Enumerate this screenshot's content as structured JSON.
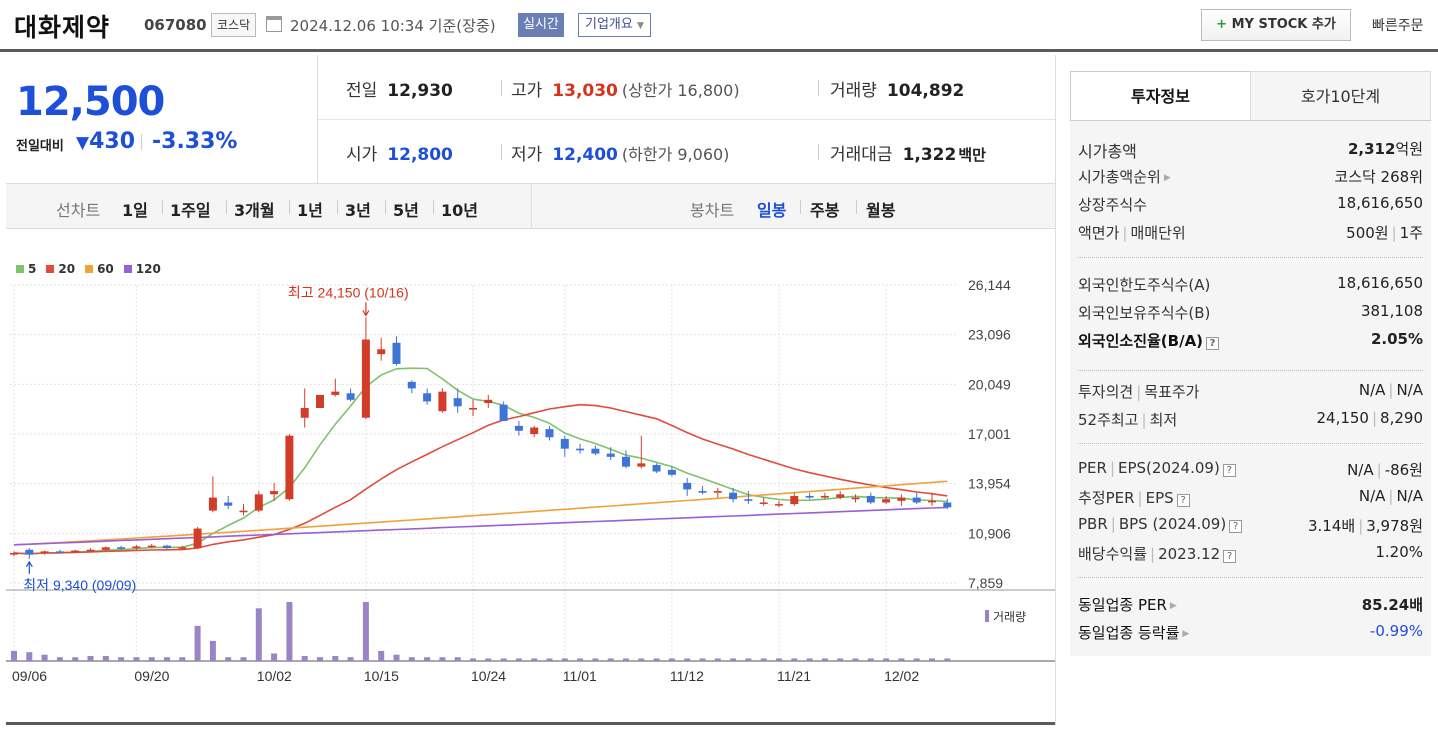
{
  "header": {
    "company_name": "대화제약",
    "code": "067080",
    "market": "코스닥",
    "datetime": "2024.12.06 10:34",
    "basis": "기준(장중)",
    "realtime_label": "실시간",
    "company_info_label": "기업개요",
    "mystock_label": "MY STOCK 추가",
    "quick_order_label": "빠른주문"
  },
  "summary": {
    "price": "12,500",
    "change_label": "전일대비",
    "change_value": "430",
    "change_rate": "-3.33%",
    "prev_close_label": "전일",
    "prev_close": "12,930",
    "high_label": "고가",
    "high": "13,030",
    "upper_limit": "(상한가 16,800)",
    "volume_label": "거래량",
    "volume": "104,892",
    "open_label": "시가",
    "open": "12,800",
    "low_label": "저가",
    "low": "12,400",
    "lower_limit": "(하한가 9,060)",
    "amount_label": "거래대금",
    "amount": "1,322",
    "amount_unit": "백만"
  },
  "periods": {
    "line_chart_label": "선차트",
    "line_options": [
      "1일",
      "1주일",
      "3개월",
      "1년",
      "3년",
      "5년",
      "10년"
    ],
    "candle_chart_label": "봉차트",
    "candle_options": [
      "일봉",
      "주봉",
      "월봉"
    ],
    "candle_selected": "일봉"
  },
  "chart_data": {
    "type": "candlestick",
    "legend": [
      {
        "name": "5",
        "color": "#7cc36b"
      },
      {
        "name": "20",
        "color": "#e24a3b"
      },
      {
        "name": "60",
        "color": "#f0a23a"
      },
      {
        "name": "120",
        "color": "#9a5fd6"
      }
    ],
    "y_ticks": [
      "26,144",
      "23,096",
      "20,049",
      "17,001",
      "13,954",
      "10,906",
      "7,859"
    ],
    "ylim": [
      7859,
      26144
    ],
    "x_ticks": [
      "09/06",
      "09/20",
      "10/02",
      "10/15",
      "10/24",
      "11/01",
      "11/12",
      "11/21",
      "12/02"
    ],
    "x_tick_index": [
      0,
      8,
      16,
      23,
      30,
      36,
      43,
      50,
      57
    ],
    "volume_label": "거래량",
    "max_annotation": "최고 24,150 (10/16)",
    "max_index": 23,
    "max_value": 24150,
    "min_annotation": "최저 9,340 (09/09)",
    "min_index": 1,
    "min_value": 9340,
    "candles": [
      [
        9600,
        9800,
        9500,
        9700
      ],
      [
        9900,
        10000,
        9340,
        9600
      ],
      [
        9700,
        9850,
        9600,
        9800
      ],
      [
        9800,
        9900,
        9700,
        9750
      ],
      [
        9750,
        9900,
        9700,
        9850
      ],
      [
        9850,
        10000,
        9750,
        9900
      ],
      [
        9900,
        10100,
        9800,
        10050
      ],
      [
        10050,
        10150,
        9900,
        9950
      ],
      [
        10000,
        10200,
        9900,
        10100
      ],
      [
        10100,
        10250,
        10000,
        10150
      ],
      [
        10150,
        10200,
        9950,
        10000
      ],
      [
        10000,
        10150,
        9900,
        10050
      ],
      [
        10000,
        11300,
        9950,
        11200
      ],
      [
        12300,
        14400,
        12200,
        13100
      ],
      [
        12800,
        13200,
        12400,
        12600
      ],
      [
        12200,
        12700,
        12000,
        12300
      ],
      [
        12300,
        13500,
        12200,
        13300
      ],
      [
        13300,
        14000,
        12900,
        13500
      ],
      [
        13000,
        17000,
        12900,
        16900
      ],
      [
        18000,
        19800,
        17400,
        18600
      ],
      [
        18600,
        19400,
        18600,
        19400
      ],
      [
        19400,
        20400,
        19300,
        19600
      ],
      [
        19500,
        19800,
        19000,
        19100
      ],
      [
        18000,
        24150,
        17900,
        22800
      ],
      [
        21900,
        22900,
        21500,
        22200
      ],
      [
        22600,
        23000,
        21200,
        21300
      ],
      [
        20200,
        20300,
        19500,
        19800
      ],
      [
        19500,
        19800,
        18800,
        19000
      ],
      [
        18400,
        19800,
        18300,
        19600
      ],
      [
        19200,
        19800,
        18300,
        18700
      ],
      [
        18500,
        19100,
        18100,
        18600
      ],
      [
        18900,
        19400,
        18600,
        19100
      ],
      [
        18800,
        19000,
        17800,
        17800
      ],
      [
        17500,
        17800,
        16900,
        17200
      ],
      [
        17000,
        17500,
        16800,
        17400
      ],
      [
        17300,
        17500,
        16600,
        16800
      ],
      [
        16700,
        16900,
        15600,
        16100
      ],
      [
        16100,
        16400,
        15800,
        16000
      ],
      [
        16100,
        16300,
        15700,
        15800
      ],
      [
        15800,
        16200,
        15400,
        15600
      ],
      [
        15600,
        16000,
        14900,
        15000
      ],
      [
        15000,
        16900,
        14900,
        15200
      ],
      [
        15100,
        15200,
        14600,
        14700
      ],
      [
        14800,
        15000,
        14400,
        14500
      ],
      [
        14000,
        14300,
        13200,
        13600
      ],
      [
        13500,
        13800,
        13300,
        13400
      ],
      [
        13400,
        13700,
        13100,
        13500
      ],
      [
        13400,
        13700,
        12800,
        13000
      ],
      [
        13000,
        13500,
        12700,
        12900
      ],
      [
        12800,
        13100,
        12600,
        12800
      ],
      [
        12700,
        12900,
        12500,
        12700
      ],
      [
        12700,
        13400,
        12600,
        13200
      ],
      [
        13200,
        13400,
        13000,
        13100
      ],
      [
        13100,
        13400,
        13000,
        13200
      ],
      [
        13100,
        13500,
        13000,
        13300
      ],
      [
        13000,
        13300,
        12800,
        13100
      ],
      [
        13200,
        13400,
        12700,
        12800
      ],
      [
        12800,
        13200,
        12700,
        13000
      ],
      [
        12900,
        13300,
        12600,
        13100
      ],
      [
        13100,
        13400,
        12700,
        12800
      ],
      [
        12900,
        13400,
        12600,
        12900
      ],
      [
        12800,
        13030,
        12400,
        12500
      ]
    ],
    "volumes": [
      8,
      7,
      5,
      3,
      3,
      4,
      4,
      3,
      3,
      3,
      3,
      3,
      28,
      16,
      3,
      3,
      42,
      6,
      47,
      4,
      3,
      4,
      3,
      47,
      8,
      5,
      3,
      3,
      3,
      3,
      2,
      2,
      2,
      2,
      2,
      2,
      2,
      2,
      2,
      2,
      2,
      2,
      2,
      2,
      2,
      2,
      2,
      2,
      2,
      2,
      2,
      2,
      2,
      2,
      2,
      2,
      2,
      2,
      2,
      2,
      2,
      2
    ]
  },
  "right_panel": {
    "tab_invest": "투자정보",
    "tab_hoga": "호가10단계",
    "market_cap_label": "시가총액",
    "market_cap": "2,312",
    "market_cap_unit": "억원",
    "market_cap_rank_label": "시가총액순위",
    "market_cap_rank": "코스닥 268위",
    "listed_shares_label": "상장주식수",
    "listed_shares": "18,616,650",
    "par_label": "액면가",
    "unit_label": "매매단위",
    "par_value": "500원",
    "trade_unit": "1주",
    "foreign_limit_label": "외국인한도주식수(A)",
    "foreign_limit": "18,616,650",
    "foreign_hold_label": "외국인보유주식수(B)",
    "foreign_hold": "381,108",
    "foreign_ratio_label": "외국인소진율(B/A)",
    "foreign_ratio": "2.05%",
    "opinion_label": "투자의견",
    "target_label": "목표주가",
    "opinion": "N/A",
    "target": "N/A",
    "high52_label": "52주최고",
    "low52_label": "최저",
    "high52": "24,150",
    "low52": "8,290",
    "per_label": "PER",
    "eps_label": "EPS(2024.09)",
    "per": "N/A",
    "eps": "-86원",
    "est_per_label": "추정PER",
    "est_eps_label": "EPS",
    "est_per": "N/A",
    "est_eps": "N/A",
    "pbr_label": "PBR",
    "bps_label": "BPS (2024.09)",
    "pbr": "3.14배",
    "bps": "3,978원",
    "dividend_label": "배당수익률",
    "dividend_date": "2023.12",
    "dividend": "1.20%",
    "sector_per_label": "동일업종 PER",
    "sector_per": "85.24배",
    "sector_change_label": "동일업종 등락률",
    "sector_change": "-0.99%"
  }
}
